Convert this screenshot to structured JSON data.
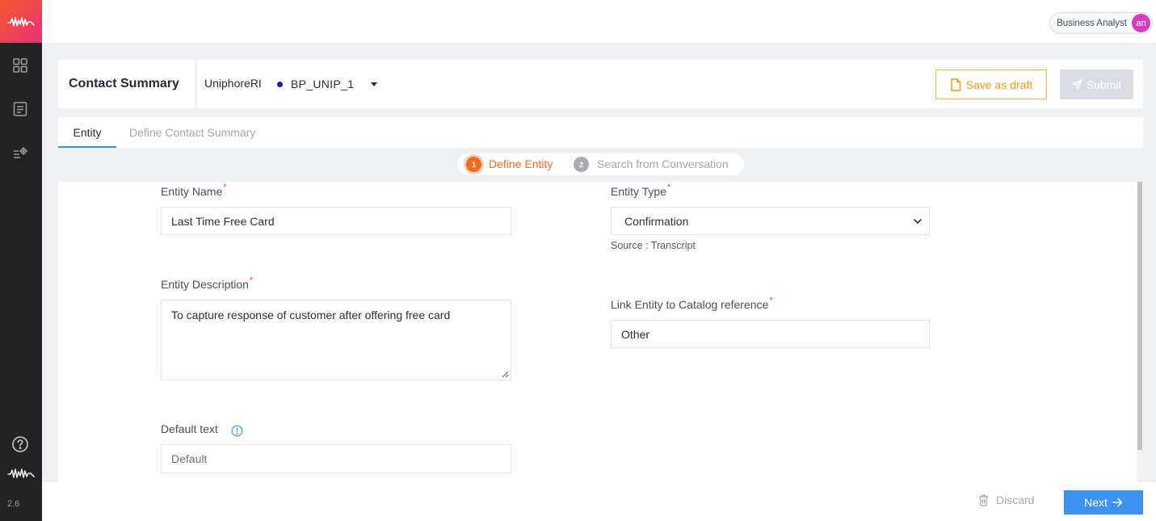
{
  "app": {
    "version": "2.6"
  },
  "topbar": {
    "role": "Business Analyst",
    "avatar_initials": "an"
  },
  "header": {
    "title": "Contact Summary",
    "project": "UniphoreRI",
    "environment": "BP_UNIP_1",
    "save_draft_label": "Save as draft",
    "submit_label": "Submit"
  },
  "tabs": [
    {
      "label": "Entity",
      "active": true
    },
    {
      "label": "Define Contact Summary",
      "active": false
    }
  ],
  "stepper": [
    {
      "num": "1",
      "label": "Define Entity",
      "active": true
    },
    {
      "num": "2",
      "label": "Search from Conversation",
      "active": false
    }
  ],
  "form": {
    "entity_name": {
      "label": "Entity Name",
      "required_mark": "*",
      "value": "Last Time Free Card"
    },
    "entity_type": {
      "label": "Entity Type",
      "required_mark": "*",
      "value": "Confirmation",
      "hint": "Source : Transcript"
    },
    "entity_description": {
      "label": "Entity Description",
      "required_mark": "*",
      "value": "To capture response of customer after offering free card"
    },
    "catalog_reference": {
      "label": "Link Entity to Catalog reference",
      "required_mark": "*",
      "value": "Other"
    },
    "default_text": {
      "label": "Default text",
      "placeholder": "Default"
    }
  },
  "footer": {
    "discard_label": "Discard",
    "next_label": "Next"
  },
  "colors": {
    "accent_orange": "#f26a1e",
    "primary_blue": "#3e92f2",
    "draft_yellow": "#ee9a1a",
    "brand_gradient_start": "#f3592d",
    "brand_gradient_end": "#ea2f77"
  }
}
